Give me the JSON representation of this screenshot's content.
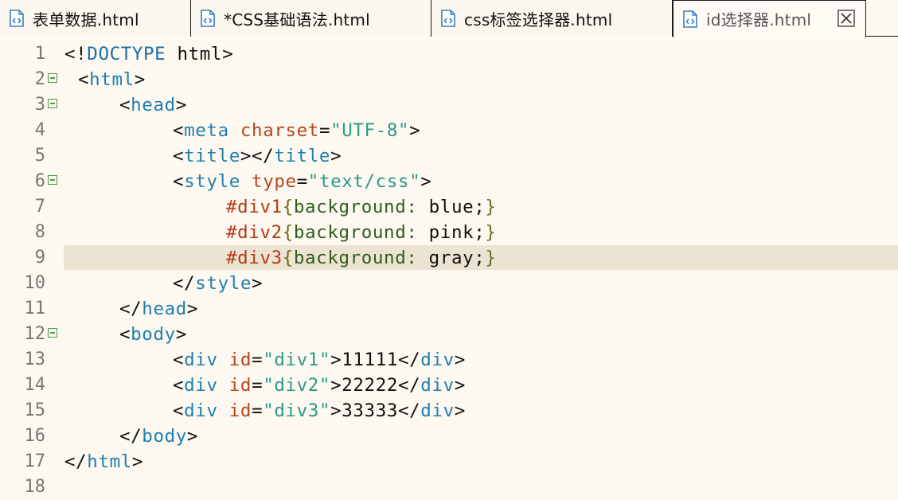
{
  "tabs": [
    {
      "label": "表单数据.html",
      "active": false
    },
    {
      "label": "*CSS基础语法.html",
      "active": false
    },
    {
      "label": "css标签选择器.html",
      "active": false
    },
    {
      "label": "id选择器.html",
      "active": true
    }
  ],
  "editor": {
    "highlighted_line": 9,
    "lines": [
      {
        "num": "1"
      },
      {
        "num": "2"
      },
      {
        "num": "3"
      },
      {
        "num": "4"
      },
      {
        "num": "5"
      },
      {
        "num": "6"
      },
      {
        "num": "7"
      },
      {
        "num": "8"
      },
      {
        "num": "9"
      },
      {
        "num": "10"
      },
      {
        "num": "11"
      },
      {
        "num": "12"
      },
      {
        "num": "13"
      },
      {
        "num": "14"
      },
      {
        "num": "15"
      },
      {
        "num": "16"
      },
      {
        "num": "17"
      },
      {
        "num": "18"
      }
    ],
    "code": {
      "l1": {
        "a": "<!",
        "b": "DOCTYPE",
        "c": " html",
        "d": ">"
      },
      "l2": {
        "a": "<",
        "b": "html",
        "c": ">"
      },
      "l3": {
        "a": "<",
        "b": "head",
        "c": ">"
      },
      "l4": {
        "a": "<",
        "b": "meta",
        "attr": "charset",
        "eq": "=",
        "val": "\"UTF-8\"",
        "c": ">"
      },
      "l5": {
        "a": "<",
        "b": "title",
        "c": "></",
        "d": "title",
        "e": ">"
      },
      "l6": {
        "a": "<",
        "b": "style",
        "attr": "type",
        "eq": "=",
        "val": "\"text/css\"",
        "c": ">"
      },
      "l7": {
        "sel": "#div1",
        "ob": "{",
        "prop": "background",
        "colon": ": ",
        "val": "blue",
        "semi": ";",
        "cb": "}"
      },
      "l8": {
        "sel": "#div2",
        "ob": "{",
        "prop": "background",
        "colon": ": ",
        "val": "pink",
        "semi": ";",
        "cb": "}"
      },
      "l9": {
        "sel": "#div3",
        "ob": "{",
        "prop": "background",
        "colon": ": ",
        "val": "gray",
        "semi": ";",
        "cb": "}"
      },
      "l10": {
        "a": "</",
        "b": "style",
        "c": ">"
      },
      "l11": {
        "a": "</",
        "b": "head",
        "c": ">"
      },
      "l12": {
        "a": "<",
        "b": "body",
        "c": ">"
      },
      "l13": {
        "a": "<",
        "b": "div",
        "attr": "id",
        "eq": "=",
        "val": "\"div1\"",
        "c": ">",
        "text": "11111",
        "d": "</",
        "e": "div",
        "f": ">"
      },
      "l14": {
        "a": "<",
        "b": "div",
        "attr": "id",
        "eq": "=",
        "val": "\"div2\"",
        "c": ">",
        "text": "22222",
        "d": "</",
        "e": "div",
        "f": ">"
      },
      "l15": {
        "a": "<",
        "b": "div",
        "attr": "id",
        "eq": "=",
        "val": "\"div3\"",
        "c": ">",
        "text": "33333",
        "d": "</",
        "e": "div",
        "f": ">"
      },
      "l16": {
        "a": "</",
        "b": "body",
        "c": ">"
      },
      "l17": {
        "a": "</",
        "b": "html",
        "c": ">"
      }
    }
  },
  "icons": {
    "tab_file": "html-file-icon",
    "tab_close": "close-icon",
    "fold": "fold-collapse-icon"
  },
  "colors": {
    "tag": "#1f7fb0",
    "attribute": "#b8461f",
    "string": "#2b9a87",
    "selector": "#b33a1a",
    "property": "#2e5f1e",
    "highlight": "#ece3d2"
  }
}
